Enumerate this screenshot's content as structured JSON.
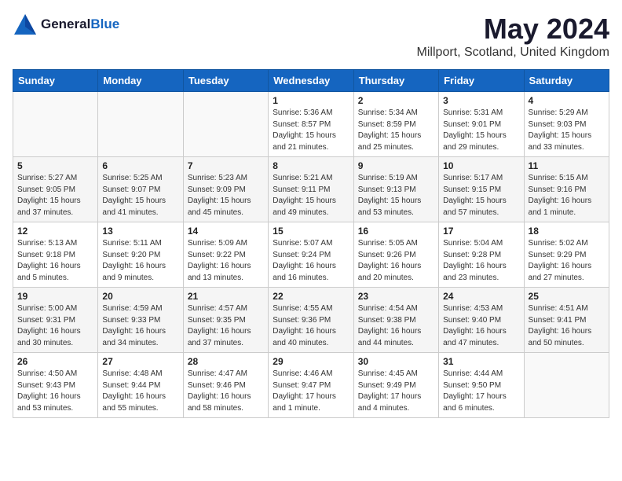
{
  "logo": {
    "general": "General",
    "blue": "Blue"
  },
  "title": "May 2024",
  "location": "Millport, Scotland, United Kingdom",
  "weekdays": [
    "Sunday",
    "Monday",
    "Tuesday",
    "Wednesday",
    "Thursday",
    "Friday",
    "Saturday"
  ],
  "weeks": [
    [
      {
        "day": "",
        "info": ""
      },
      {
        "day": "",
        "info": ""
      },
      {
        "day": "",
        "info": ""
      },
      {
        "day": "1",
        "info": "Sunrise: 5:36 AM\nSunset: 8:57 PM\nDaylight: 15 hours\nand 21 minutes."
      },
      {
        "day": "2",
        "info": "Sunrise: 5:34 AM\nSunset: 8:59 PM\nDaylight: 15 hours\nand 25 minutes."
      },
      {
        "day": "3",
        "info": "Sunrise: 5:31 AM\nSunset: 9:01 PM\nDaylight: 15 hours\nand 29 minutes."
      },
      {
        "day": "4",
        "info": "Sunrise: 5:29 AM\nSunset: 9:03 PM\nDaylight: 15 hours\nand 33 minutes."
      }
    ],
    [
      {
        "day": "5",
        "info": "Sunrise: 5:27 AM\nSunset: 9:05 PM\nDaylight: 15 hours\nand 37 minutes."
      },
      {
        "day": "6",
        "info": "Sunrise: 5:25 AM\nSunset: 9:07 PM\nDaylight: 15 hours\nand 41 minutes."
      },
      {
        "day": "7",
        "info": "Sunrise: 5:23 AM\nSunset: 9:09 PM\nDaylight: 15 hours\nand 45 minutes."
      },
      {
        "day": "8",
        "info": "Sunrise: 5:21 AM\nSunset: 9:11 PM\nDaylight: 15 hours\nand 49 minutes."
      },
      {
        "day": "9",
        "info": "Sunrise: 5:19 AM\nSunset: 9:13 PM\nDaylight: 15 hours\nand 53 minutes."
      },
      {
        "day": "10",
        "info": "Sunrise: 5:17 AM\nSunset: 9:15 PM\nDaylight: 15 hours\nand 57 minutes."
      },
      {
        "day": "11",
        "info": "Sunrise: 5:15 AM\nSunset: 9:16 PM\nDaylight: 16 hours\nand 1 minute."
      }
    ],
    [
      {
        "day": "12",
        "info": "Sunrise: 5:13 AM\nSunset: 9:18 PM\nDaylight: 16 hours\nand 5 minutes."
      },
      {
        "day": "13",
        "info": "Sunrise: 5:11 AM\nSunset: 9:20 PM\nDaylight: 16 hours\nand 9 minutes."
      },
      {
        "day": "14",
        "info": "Sunrise: 5:09 AM\nSunset: 9:22 PM\nDaylight: 16 hours\nand 13 minutes."
      },
      {
        "day": "15",
        "info": "Sunrise: 5:07 AM\nSunset: 9:24 PM\nDaylight: 16 hours\nand 16 minutes."
      },
      {
        "day": "16",
        "info": "Sunrise: 5:05 AM\nSunset: 9:26 PM\nDaylight: 16 hours\nand 20 minutes."
      },
      {
        "day": "17",
        "info": "Sunrise: 5:04 AM\nSunset: 9:28 PM\nDaylight: 16 hours\nand 23 minutes."
      },
      {
        "day": "18",
        "info": "Sunrise: 5:02 AM\nSunset: 9:29 PM\nDaylight: 16 hours\nand 27 minutes."
      }
    ],
    [
      {
        "day": "19",
        "info": "Sunrise: 5:00 AM\nSunset: 9:31 PM\nDaylight: 16 hours\nand 30 minutes."
      },
      {
        "day": "20",
        "info": "Sunrise: 4:59 AM\nSunset: 9:33 PM\nDaylight: 16 hours\nand 34 minutes."
      },
      {
        "day": "21",
        "info": "Sunrise: 4:57 AM\nSunset: 9:35 PM\nDaylight: 16 hours\nand 37 minutes."
      },
      {
        "day": "22",
        "info": "Sunrise: 4:55 AM\nSunset: 9:36 PM\nDaylight: 16 hours\nand 40 minutes."
      },
      {
        "day": "23",
        "info": "Sunrise: 4:54 AM\nSunset: 9:38 PM\nDaylight: 16 hours\nand 44 minutes."
      },
      {
        "day": "24",
        "info": "Sunrise: 4:53 AM\nSunset: 9:40 PM\nDaylight: 16 hours\nand 47 minutes."
      },
      {
        "day": "25",
        "info": "Sunrise: 4:51 AM\nSunset: 9:41 PM\nDaylight: 16 hours\nand 50 minutes."
      }
    ],
    [
      {
        "day": "26",
        "info": "Sunrise: 4:50 AM\nSunset: 9:43 PM\nDaylight: 16 hours\nand 53 minutes."
      },
      {
        "day": "27",
        "info": "Sunrise: 4:48 AM\nSunset: 9:44 PM\nDaylight: 16 hours\nand 55 minutes."
      },
      {
        "day": "28",
        "info": "Sunrise: 4:47 AM\nSunset: 9:46 PM\nDaylight: 16 hours\nand 58 minutes."
      },
      {
        "day": "29",
        "info": "Sunrise: 4:46 AM\nSunset: 9:47 PM\nDaylight: 17 hours\nand 1 minute."
      },
      {
        "day": "30",
        "info": "Sunrise: 4:45 AM\nSunset: 9:49 PM\nDaylight: 17 hours\nand 4 minutes."
      },
      {
        "day": "31",
        "info": "Sunrise: 4:44 AM\nSunset: 9:50 PM\nDaylight: 17 hours\nand 6 minutes."
      },
      {
        "day": "",
        "info": ""
      }
    ]
  ]
}
